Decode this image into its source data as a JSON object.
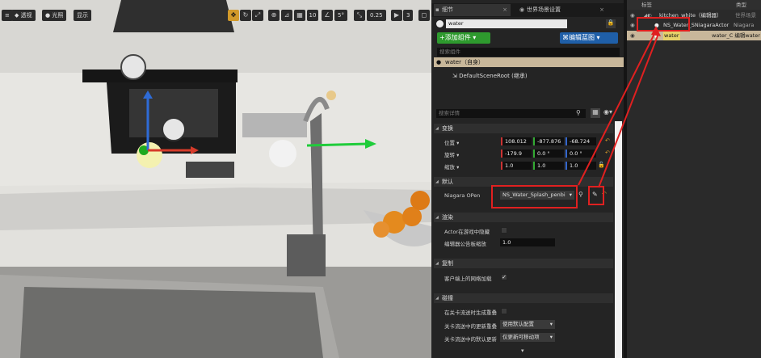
{
  "viewport": {
    "toolbar": {
      "perspective_label": "透视",
      "lit_label": "光照",
      "show_label": "显示",
      "grid_snap_value": "10",
      "rotation_snap_value": "5°",
      "scale_snap_value": "0.25",
      "camera_speed_value": "3"
    }
  },
  "details": {
    "tabs": [
      {
        "label": "细节"
      },
      {
        "label": "世界场景设置"
      }
    ],
    "actor_name_value": "water",
    "add_component_label": "添加组件",
    "edit_blueprint_label": "编辑蓝图",
    "component_search_placeholder": "搜索组件",
    "components": [
      {
        "label": "water（自身）"
      },
      {
        "label": "DefaultSceneRoot (继承)"
      }
    ],
    "details_search_placeholder": "搜索详情",
    "sections": {
      "transform": "变换",
      "default": "默认",
      "rendering": "渲染",
      "replication": "复制",
      "collision": "碰撞"
    },
    "transform": {
      "location_label": "位置",
      "rotation_label": "旋转",
      "scale_label": "缩放",
      "location": [
        "108.012",
        "-877.876",
        "-68.724"
      ],
      "rotation": [
        "-179.9",
        "0.0 °",
        "0.0 °"
      ],
      "scale": [
        "1.0",
        "1.0",
        "1.0"
      ]
    },
    "default": {
      "niagara_label": "Niagara OPen",
      "niagara_value": "NS_Water_Splash_penbi"
    },
    "rendering": {
      "hidden_in_game_label": "Actor在游戏中隐藏",
      "billboard_scale_label": "编辑器公告板缩放",
      "billboard_scale_value": "1.0"
    },
    "replication": {
      "net_load_label": "客户端上的网络加载"
    },
    "collision": {
      "generate_overlap_label": "在关卡流送时生成重叠",
      "update_overlap_label": "关卡流送中的更新重叠",
      "update_overlap_value": "使用默认配置",
      "default_update_label": "关卡流送中的默认更新",
      "default_update_value": "仅更新可移动项"
    }
  },
  "outliner": {
    "header_label": "标签",
    "header_type": "类型",
    "items": [
      {
        "label": "kitchen_white（编辑器）",
        "type": "世界场景"
      },
      {
        "label": "NS_Water_SNiagaraActor",
        "type": "Niagara"
      },
      {
        "label": "water",
        "type": "water_C 编辑water"
      }
    ]
  },
  "colors": {
    "accent_green": "#2e9a2e",
    "accent_blue": "#1f5fa8",
    "highlight_red": "#e02020",
    "selection_orange": "#d29a2a"
  }
}
